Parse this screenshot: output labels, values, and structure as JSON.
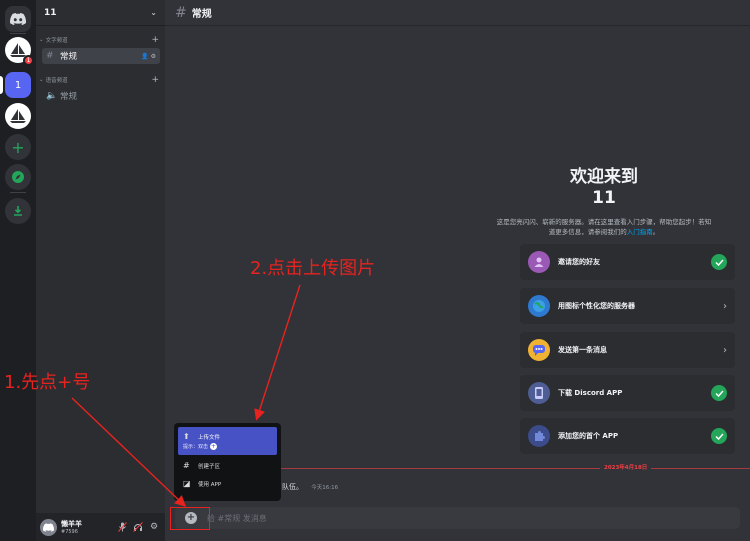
{
  "rail": {
    "server_11_label": "1",
    "server_a_badge": "1"
  },
  "sidebar": {
    "guild_name": "11",
    "categories": [
      {
        "label": "文字频道"
      },
      {
        "label": "语音频道"
      }
    ],
    "channels": [
      {
        "label": "常规",
        "type": "text"
      },
      {
        "label": "常规",
        "type": "voice"
      }
    ],
    "user": {
      "name": "懒羊羊",
      "tag": "#7596"
    }
  },
  "main": {
    "channel_title": "常规",
    "welcome": {
      "title": "欢迎来到",
      "server_name": "11",
      "description": "这是您亮闪闪、崭新的服务器。请在这里查看入门步骤，帮助您起步！若知道更多信息，请参阅我们的",
      "link": "入门指南",
      "period": "。"
    },
    "tasks": [
      {
        "label": "邀请您的好友",
        "done": true
      },
      {
        "label": "用图标个性化您的服务器",
        "done": false
      },
      {
        "label": "发送第一条消息",
        "done": false
      },
      {
        "label": "下载 Discord APP",
        "done": true
      },
      {
        "label": "添加您的首个 APP",
        "done": true
      }
    ],
    "date_divider": "2023年4月18日",
    "message": {
      "text": "了队伍。",
      "time": "今天16:16"
    },
    "composer": {
      "placeholder": "给 #常规 发消息"
    }
  },
  "menu": {
    "upload": {
      "label": "上传文件",
      "hint": "提示：双击"
    },
    "thread": {
      "label": "创建子区"
    },
    "app": {
      "label": "使用 APP"
    }
  },
  "annotations": {
    "step1": "1.先点+号",
    "step2": "2.点击上传图片"
  },
  "colors": {
    "accent": "#5865f2",
    "success": "#23a55a",
    "danger": "#f23f43",
    "annotation": "#e8231f"
  }
}
